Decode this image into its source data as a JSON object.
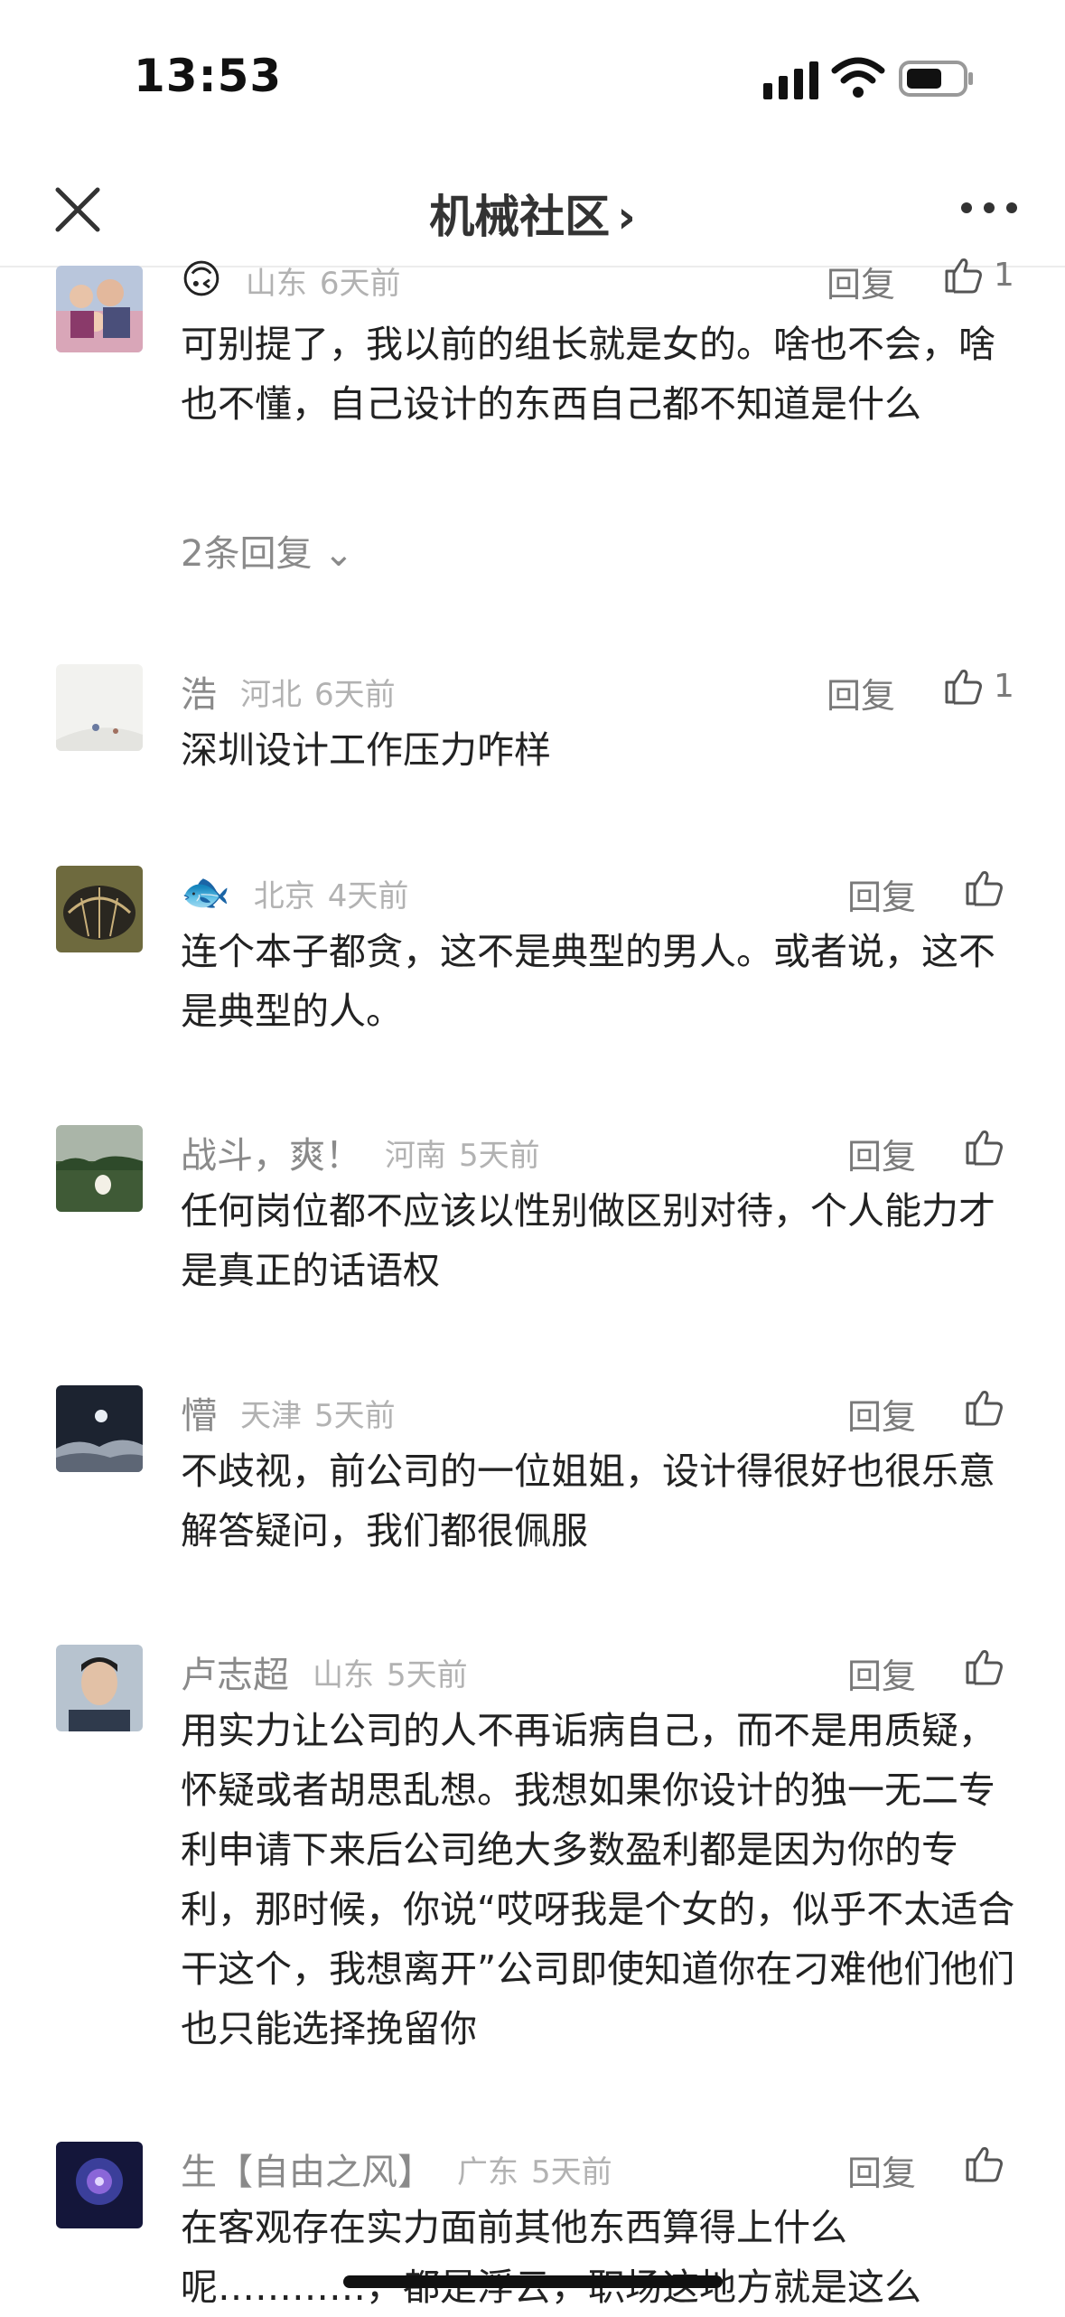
{
  "status_bar": {
    "time": "13:53"
  },
  "nav": {
    "title": "机械社区",
    "chevron": "›"
  },
  "comments": [
    {
      "user": "",
      "user_emoji": "🙃",
      "location": "山东",
      "time_ago": "6天前",
      "reply_label": "回复",
      "likes": "1",
      "text": "可别提了，我以前的组长就是女的。啥也不会，啥也不懂，自己设计的东西自己都不知道是什么",
      "replies_label": "2条回复"
    },
    {
      "user": "浩",
      "location": "河北",
      "time_ago": "6天前",
      "reply_label": "回复",
      "likes": "1",
      "text": "深圳设计工作压力咋样"
    },
    {
      "user": "",
      "user_emoji": "🐟",
      "location": "北京",
      "time_ago": "4天前",
      "reply_label": "回复",
      "text": "连个本子都贪，这不是典型的男人。或者说，这不是典型的人。"
    },
    {
      "user": "战斗，爽！",
      "location": "河南",
      "time_ago": "5天前",
      "reply_label": "回复",
      "text": "任何岗位都不应该以性别做区别对待，个人能力才是真正的话语权"
    },
    {
      "user": "懵",
      "location": "天津",
      "time_ago": "5天前",
      "reply_label": "回复",
      "text": "不歧视，前公司的一位姐姐，设计得很好也很乐意解答疑问，我们都很佩服"
    },
    {
      "user": "卢志超",
      "location": "山东",
      "time_ago": "5天前",
      "reply_label": "回复",
      "text": "用实力让公司的人不再诟病自己，而不是用质疑，怀疑或者胡思乱想。我想如果你设计的独一无二专利申请下来后公司绝大多数盈利都是因为你的专利，那时候，你说“哎呀我是个女的，似乎不太适合干这个，我想离开”公司即使知道你在刁难他们他们也只能选择挽留你"
    },
    {
      "user": "生【自由之风】",
      "location": "广东",
      "time_ago": "5天前",
      "reply_label": "回复",
      "text": "在客观存在实力面前其他东西算得上什么呢…………，都是浮云，职场这地方就是这么"
    }
  ]
}
